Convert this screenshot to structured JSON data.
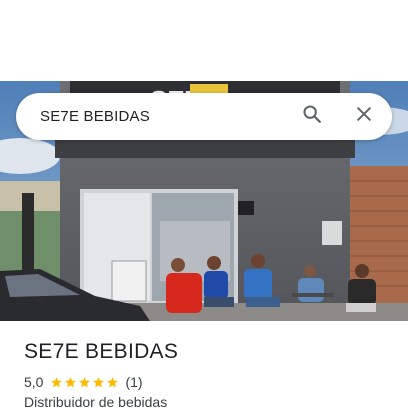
{
  "search": {
    "query": "SE7E BEBIDAS"
  },
  "place": {
    "name": "SE7E BEBIDAS",
    "rating": "5,0",
    "star_count": 5,
    "review_count": "(1)",
    "category": "Distribuidor de bebidas"
  },
  "colors": {
    "star": "#fbbc04",
    "text_primary": "#202124",
    "text_secondary": "#3c4043",
    "icon": "#5f6368"
  },
  "icons": {
    "search": "search-icon",
    "close": "close-icon",
    "star": "star-icon"
  }
}
